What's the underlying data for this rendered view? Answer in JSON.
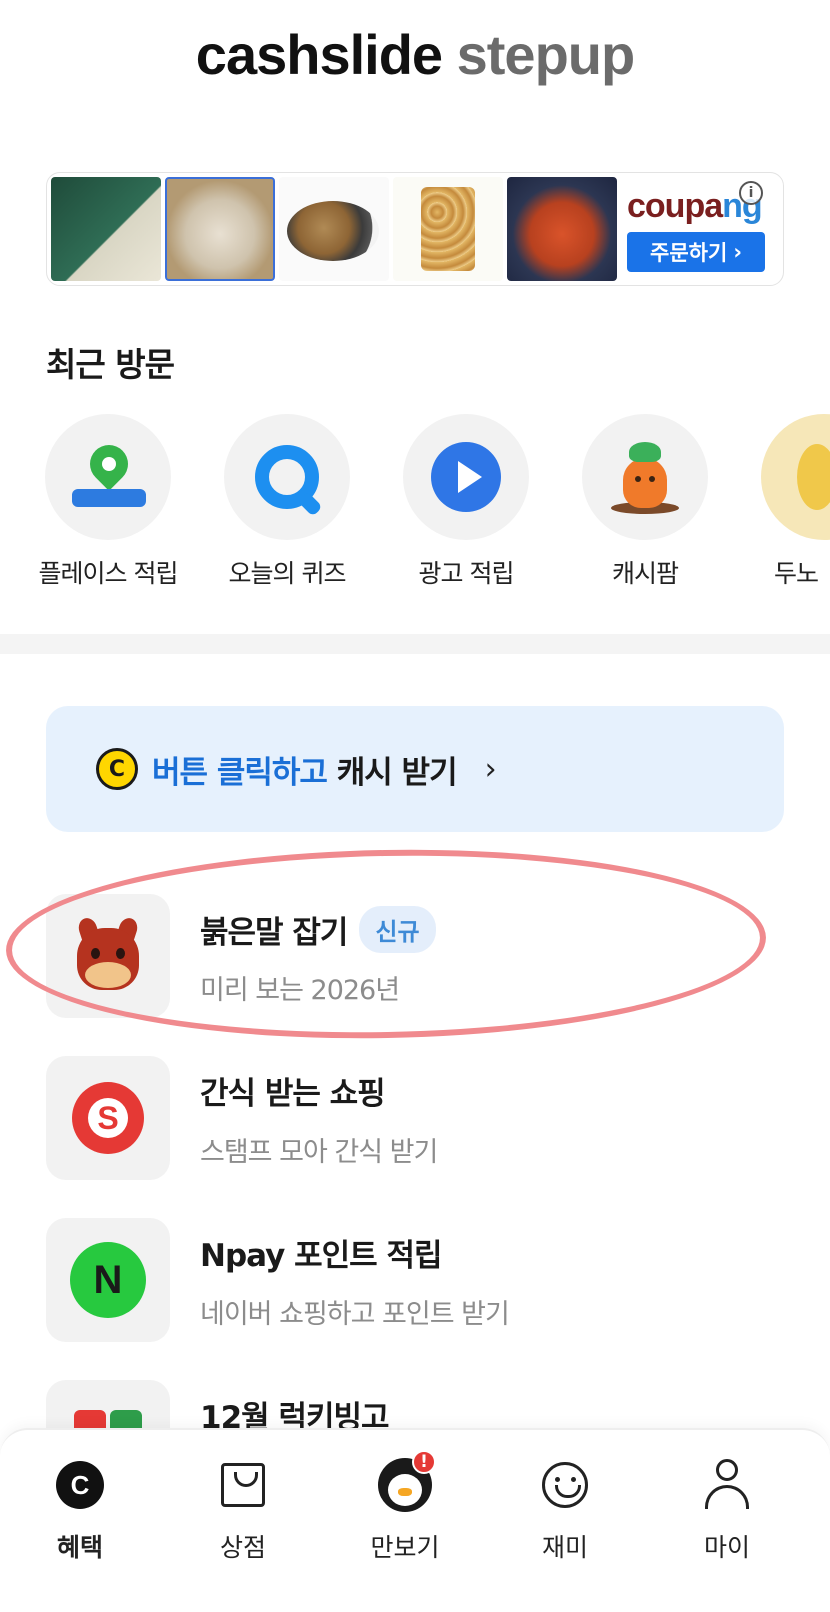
{
  "header": {
    "logo_primary": "cashslide",
    "logo_secondary": "stepup"
  },
  "ad": {
    "brand": "coupang",
    "brand_main": "coupa",
    "brand_tail": "ng",
    "cta_label": "주문하기",
    "cta_chevron": "›",
    "info_label": "i"
  },
  "recent": {
    "title": "최근 방문",
    "items": [
      {
        "label": "플레이스 적립",
        "icon": "map-pin-icon"
      },
      {
        "label": "오늘의 퀴즈",
        "icon": "quiz-icon"
      },
      {
        "label": "광고 적립",
        "icon": "play-icon"
      },
      {
        "label": "캐시팜",
        "icon": "carrot-icon"
      },
      {
        "label": "두노",
        "icon": "partial-icon"
      }
    ]
  },
  "cash_banner": {
    "coin": "C",
    "highlight": "버튼 클릭하고",
    "rest": " 캐시 받기",
    "chevron": "›"
  },
  "features": [
    {
      "title": "붉은말 잡기",
      "badge": "신규",
      "subtitle": "미리 보는 2026년",
      "icon": "horse-icon"
    },
    {
      "title": "간식 받는 쇼핑",
      "subtitle": "스탬프 모아 간식 받기",
      "icon": "s-icon",
      "icon_letter": "S"
    },
    {
      "title": "Npay 포인트 적립",
      "subtitle": "네이버 쇼핑하고 포인트 받기",
      "icon": "npay-icon",
      "icon_letter": "N"
    },
    {
      "title": "12월 럭키빙고",
      "icon": "bingo-icon"
    }
  ],
  "bottom_nav": [
    {
      "label": "혜택",
      "icon": "cash-c-icon",
      "active": true,
      "icon_letter": "C"
    },
    {
      "label": "상점",
      "icon": "shopping-bag-icon"
    },
    {
      "label": "만보기",
      "icon": "penguin-icon",
      "alert": "!"
    },
    {
      "label": "재미",
      "icon": "smiley-icon"
    },
    {
      "label": "마이",
      "icon": "person-icon"
    }
  ],
  "colors": {
    "accent_blue": "#1a6fd6",
    "banner_bg": "#e6f1fd",
    "annotation": "#f08a8e"
  }
}
